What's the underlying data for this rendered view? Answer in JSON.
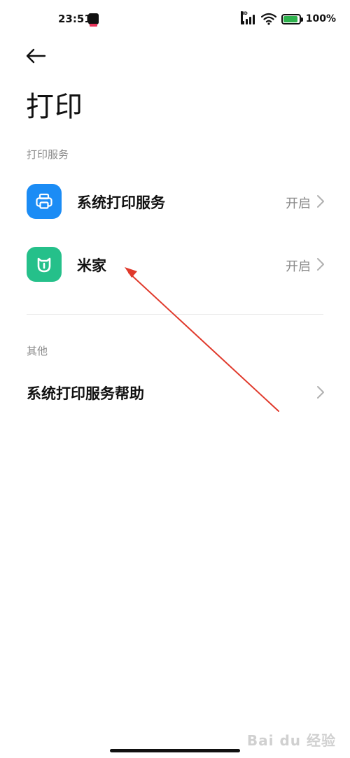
{
  "status_bar": {
    "time": "23:51",
    "network_badge": "HD",
    "battery_percent": "100%",
    "battery_color": "#2eb24d"
  },
  "header": {
    "back_icon": "arrow-left-icon",
    "title": "打印"
  },
  "sections": {
    "print_services": {
      "header": "打印服务",
      "items": [
        {
          "label": "系统打印服务",
          "value": "开启",
          "icon": "printer-icon",
          "icon_color": "#1b8cf5"
        },
        {
          "label": "米家",
          "value": "开启",
          "icon": "mijia-icon",
          "icon_color": "#25c08a"
        }
      ]
    },
    "other": {
      "header": "其他",
      "items": [
        {
          "label": "系统打印服务帮助"
        }
      ]
    }
  },
  "annotation": {
    "arrow_color": "#e0392b"
  },
  "watermark": "Bai du 经验"
}
